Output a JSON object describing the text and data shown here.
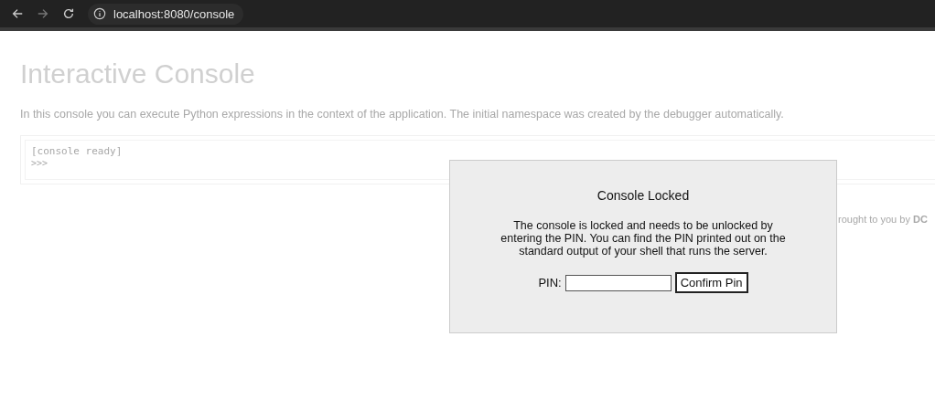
{
  "browser": {
    "url": "localhost:8080/console"
  },
  "page": {
    "title": "Interactive Console",
    "description": "In this console you can execute Python expressions in the context of the application. The initial namespace was created by the debugger automatically.",
    "console_lines": [
      "[console ready]",
      ">>>"
    ],
    "footer": "rought to you by **DC**"
  },
  "dialog": {
    "title": "Console Locked",
    "message": "The console is locked and needs to be unlocked by entering the PIN. You can find the PIN printed out on the standard output of your shell that runs the server.",
    "pin_label": "PIN:",
    "button": "Confirm Pin"
  }
}
